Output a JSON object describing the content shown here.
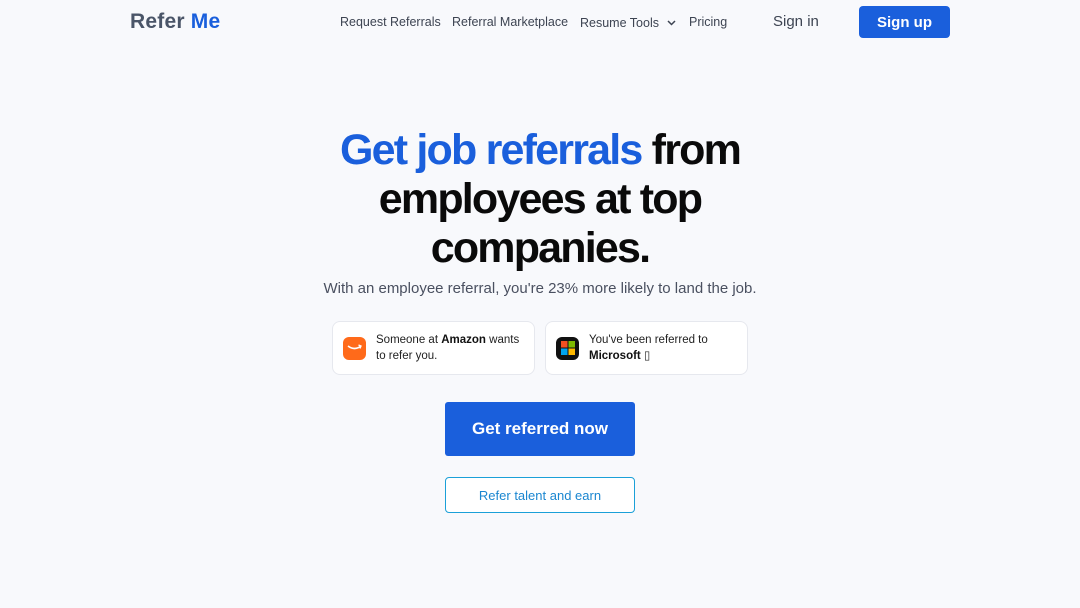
{
  "nav": {
    "logo_part1": "Refer",
    "logo_part2": "Me",
    "links": [
      {
        "label": "Request Referrals"
      },
      {
        "label": "Referral Marketplace"
      },
      {
        "label": "Resume Tools"
      },
      {
        "label": "Pricing"
      }
    ],
    "signin": "Sign in",
    "signup": "Sign up"
  },
  "hero": {
    "headline_highlight": "Get job referrals",
    "headline_rest_1": " from",
    "headline_rest_2": "employees at top",
    "headline_rest_3": "companies.",
    "subtitle": "With an employee referral, you're 23% more likely to land the job."
  },
  "cards": [
    {
      "icon": "amazon-icon",
      "prefix": "Someone at ",
      "company": "Amazon",
      "suffix": " wants",
      "line2": "to refer you."
    },
    {
      "icon": "microsoft-icon",
      "line1": "You've been referred to",
      "company": "Microsoft",
      "suffix": " ▯"
    }
  ],
  "cta": {
    "primary": "Get referred now",
    "secondary": "Refer talent and earn"
  },
  "colors": {
    "brand_blue": "#1a5fdc",
    "background": "#f8f9fc",
    "amazon_orange": "#ff6a1a",
    "outline_blue": "#1ba0d8"
  }
}
